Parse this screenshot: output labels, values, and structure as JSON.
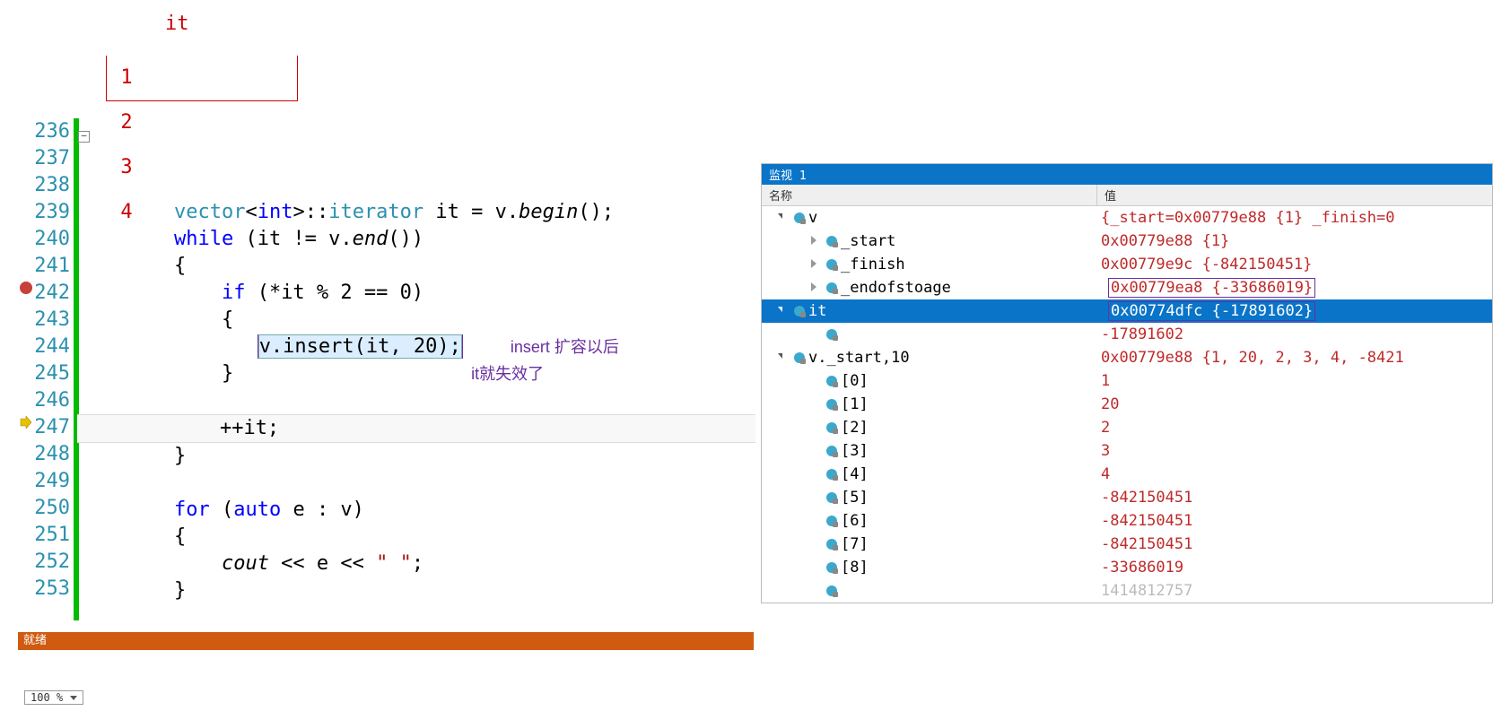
{
  "diagram": {
    "pointer": "it",
    "cells": [
      "1",
      "2",
      "3",
      "4"
    ]
  },
  "annotation": {
    "line1": "insert 扩容以后",
    "line2": "it就失效了"
  },
  "code": {
    "lines": [
      236,
      237,
      238,
      239,
      240,
      241,
      242,
      243,
      244,
      245,
      246,
      247,
      248,
      249,
      250,
      251,
      252,
      253
    ],
    "l239_a": "vector",
    "l239_b": "int",
    "l239_c": "::",
    "l239_d": "iterator",
    "l239_e": " it = v.",
    "l239_f": "begin",
    "l239_g": "();",
    "l240_a": "while",
    "l240_b": " (it != v.",
    "l240_c": "end",
    "l240_d": "())",
    "l241": "{",
    "l242_a": "if",
    "l242_b": " (*it % 2 == 0)",
    "l243": "{",
    "l244": "v.insert(it, 20);",
    "l245": "}",
    "l247": "++it;",
    "l248": "}",
    "l250_a": "for",
    "l250_b": " (",
    "l250_c": "auto",
    "l250_d": " e : v)",
    "l251": "{",
    "l252_a": "cout",
    "l252_b": " << e << ",
    "l252_c": "\" \"",
    "l252_d": ";",
    "l253": "}"
  },
  "zoom": "100 %",
  "status": "就绪",
  "watch": {
    "title": "监视 1",
    "headers": {
      "name": "名称",
      "value": "值"
    },
    "rows": [
      {
        "d": 0,
        "exp": "open",
        "name": "v",
        "val": "{_start=0x00779e88 {1} _finish=0"
      },
      {
        "d": 1,
        "exp": "close",
        "name": "_start",
        "val": "0x00779e88 {1}"
      },
      {
        "d": 1,
        "exp": "close",
        "name": "_finish",
        "val": "0x00779e9c {-842150451}"
      },
      {
        "d": 1,
        "exp": "close",
        "name": "_endofstoage",
        "val": "0x00779ea8 {-33686019}",
        "valbox": true
      },
      {
        "d": 0,
        "exp": "open",
        "name": "it",
        "val": "0x00774dfc {-17891602}",
        "sel": true,
        "valbox": true
      },
      {
        "d": 1,
        "exp": "",
        "name": "",
        "val": "-17891602"
      },
      {
        "d": 0,
        "exp": "open",
        "name": "v._start,10",
        "val": "0x00779e88 {1, 20, 2, 3, 4, -8421"
      },
      {
        "d": 1,
        "exp": "",
        "name": "[0]",
        "val": "1"
      },
      {
        "d": 1,
        "exp": "",
        "name": "[1]",
        "val": "20"
      },
      {
        "d": 1,
        "exp": "",
        "name": "[2]",
        "val": "2"
      },
      {
        "d": 1,
        "exp": "",
        "name": "[3]",
        "val": "3"
      },
      {
        "d": 1,
        "exp": "",
        "name": "[4]",
        "val": "4"
      },
      {
        "d": 1,
        "exp": "",
        "name": "[5]",
        "val": "-842150451"
      },
      {
        "d": 1,
        "exp": "",
        "name": "[6]",
        "val": "-842150451"
      },
      {
        "d": 1,
        "exp": "",
        "name": "[7]",
        "val": "-842150451"
      },
      {
        "d": 1,
        "exp": "",
        "name": "[8]",
        "val": "-33686019"
      },
      {
        "d": 1,
        "exp": "",
        "name": "",
        "val": "1414812757",
        "cut": true
      }
    ]
  }
}
